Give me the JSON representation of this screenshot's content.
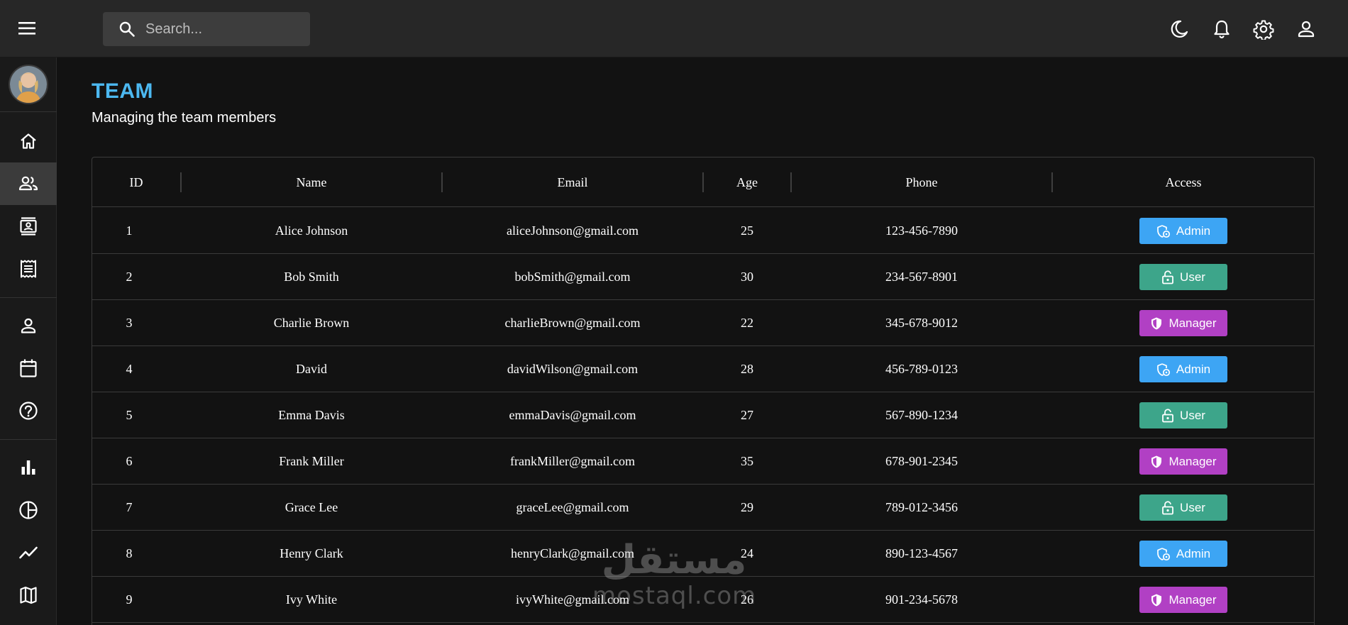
{
  "search": {
    "placeholder": "Search..."
  },
  "header": {
    "title": "TEAM",
    "subtitle": "Managing the team members"
  },
  "sidebar": {
    "items": [
      {
        "name": "home-icon"
      },
      {
        "name": "team-icon",
        "active": true
      },
      {
        "name": "contacts-icon"
      },
      {
        "name": "invoices-icon"
      },
      {
        "name": "profile-icon"
      },
      {
        "name": "calendar-icon"
      },
      {
        "name": "help-icon"
      },
      {
        "name": "bar-chart-icon"
      },
      {
        "name": "pie-chart-icon"
      },
      {
        "name": "line-chart-icon"
      },
      {
        "name": "map-icon"
      }
    ]
  },
  "topbar_icons": [
    "dark-mode-icon",
    "notifications-icon",
    "settings-icon",
    "user-icon"
  ],
  "table": {
    "columns": [
      "ID",
      "Name",
      "Email",
      "Age",
      "Phone",
      "Access"
    ],
    "rows": [
      {
        "id": "1",
        "name": "Alice Johnson",
        "email": "aliceJohnson@gmail.com",
        "age": "25",
        "phone": "123-456-7890",
        "access": "Admin"
      },
      {
        "id": "2",
        "name": "Bob Smith",
        "email": "bobSmith@gmail.com",
        "age": "30",
        "phone": "234-567-8901",
        "access": "User"
      },
      {
        "id": "3",
        "name": "Charlie Brown",
        "email": "charlieBrown@gmail.com",
        "age": "22",
        "phone": "345-678-9012",
        "access": "Manager"
      },
      {
        "id": "4",
        "name": "David",
        "email": "davidWilson@gmail.com",
        "age": "28",
        "phone": "456-789-0123",
        "access": "Admin"
      },
      {
        "id": "5",
        "name": "Emma Davis",
        "email": "emmaDavis@gmail.com",
        "age": "27",
        "phone": "567-890-1234",
        "access": "User"
      },
      {
        "id": "6",
        "name": "Frank Miller",
        "email": "frankMiller@gmail.com",
        "age": "35",
        "phone": "678-901-2345",
        "access": "Manager"
      },
      {
        "id": "7",
        "name": "Grace Lee",
        "email": "graceLee@gmail.com",
        "age": "29",
        "phone": "789-012-3456",
        "access": "User"
      },
      {
        "id": "8",
        "name": "Henry Clark",
        "email": "henryClark@gmail.com",
        "age": "24",
        "phone": "890-123-4567",
        "access": "Admin"
      },
      {
        "id": "9",
        "name": "Ivy White",
        "email": "ivyWhite@gmail.com",
        "age": "26",
        "phone": "901-234-5678",
        "access": "Manager"
      }
    ]
  },
  "access_colors": {
    "Admin": "#3da5f4",
    "User": "#3da58a",
    "Manager": "#b140c4"
  },
  "colors": {
    "accent": "#4cb8f0",
    "background": "#121212",
    "topbar": "#272727"
  },
  "watermark": {
    "arabic": "مستقل",
    "latin": "mostaql.com"
  }
}
